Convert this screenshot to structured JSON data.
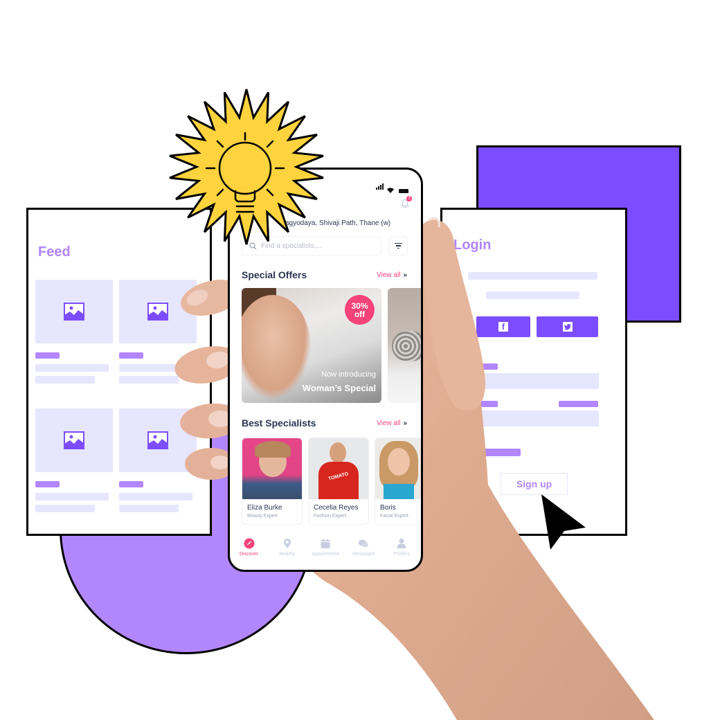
{
  "colors": {
    "accent_purple": "#7c4dff",
    "light_purple": "#b286fd",
    "placeholder_lavender": "#e6e6ff",
    "pink": "#f6437a",
    "navy_text": "#2c3552",
    "sun_yellow": "#fed33d"
  },
  "feed_card": {
    "title": "Feed",
    "tiles": [
      {
        "icon": "image-placeholder-icon"
      },
      {
        "icon": "image-placeholder-icon"
      },
      {
        "icon": "image-placeholder-icon"
      },
      {
        "icon": "image-placeholder-icon"
      }
    ]
  },
  "login_card": {
    "title": "Login",
    "social_buttons": [
      {
        "icon": "facebook-icon",
        "glyph": "f"
      },
      {
        "icon": "twitter-icon",
        "glyph": "🐦"
      }
    ],
    "signup_label": "Sign up"
  },
  "phone": {
    "status_bar": {
      "signal": "signal-icon",
      "wifi": "wifi-icon",
      "battery": "battery-icon"
    },
    "notification_count": "3",
    "address": "agyodaya, Shivaji Path, Thane (w)",
    "search_placeholder": "Find a specialists,...",
    "special_offers": {
      "title": "Special Offers",
      "view_all": "View all",
      "view_all_arrow": "»",
      "offer": {
        "badge_percent": "30%",
        "badge_off": "off",
        "subtitle": "Now introducing",
        "title": "Woman’s Special"
      }
    },
    "best_specialists": {
      "title": "Best Specialists",
      "view_all": "View all",
      "view_all_arrow": "»",
      "items": [
        {
          "name": "Eliza Burke",
          "role": "Beauty Expert"
        },
        {
          "name": "Cecelia Reyes",
          "role": "Fashion Expert"
        },
        {
          "name": "Boris",
          "role": "Facial Expert"
        }
      ]
    },
    "nav": [
      {
        "label": "Discover",
        "icon": "discover-icon",
        "active": true
      },
      {
        "label": "Nearby",
        "icon": "location-pin-icon",
        "active": false
      },
      {
        "label": "Appointment",
        "icon": "calendar-icon",
        "active": false
      },
      {
        "label": "Messages",
        "icon": "chat-icon",
        "active": false
      },
      {
        "label": "Profiles",
        "icon": "user-icon",
        "active": false
      }
    ]
  }
}
